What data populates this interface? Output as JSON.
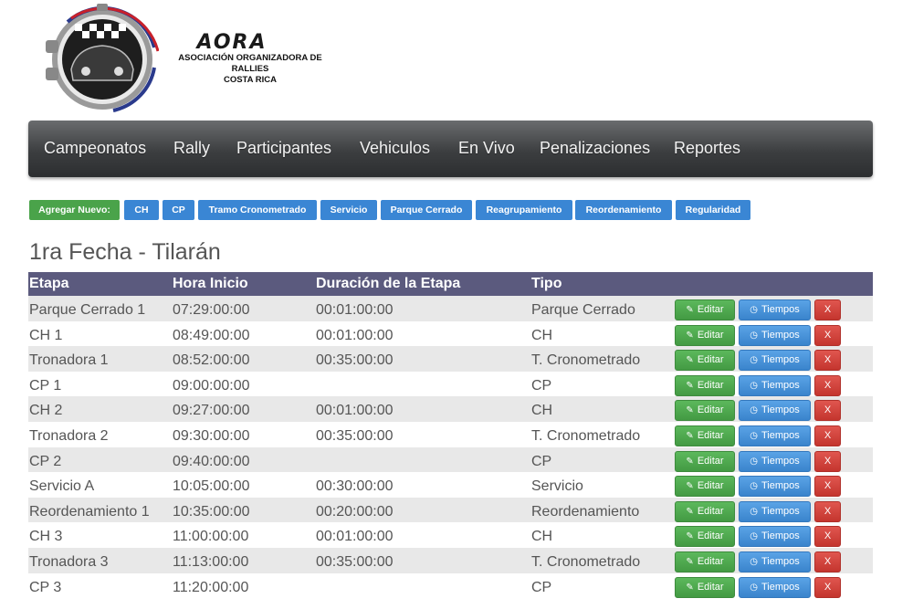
{
  "brand": {
    "name": "AORA",
    "line1": "ASOCIACIÓN ORGANIZADORA DE RALLIES",
    "line2": "COSTA RICA"
  },
  "nav": {
    "items": [
      "Campeonatos",
      "Rally",
      "Participantes",
      "Vehiculos",
      "En Vivo",
      "Penalizaciones",
      "Reportes"
    ]
  },
  "add_bar": {
    "label": "Agregar Nuevo:",
    "buttons": [
      "CH",
      "CP",
      "Tramo Cronometrado",
      "Servicio",
      "Parque Cerrado",
      "Reagrupamiento",
      "Reordenamiento",
      "Regularidad"
    ]
  },
  "page_title": "1ra Fecha - Tilarán",
  "table": {
    "headers": [
      "Etapa",
      "Hora Inicio",
      "Duración de la Etapa",
      "Tipo"
    ],
    "actions": {
      "edit": "Editar",
      "times": "Tiempos",
      "delete": "X"
    },
    "rows": [
      {
        "etapa": "Parque Cerrado 1",
        "hora": "07:29:00:00",
        "duracion": "00:01:00:00",
        "tipo": "Parque Cerrado"
      },
      {
        "etapa": "CH 1",
        "hora": "08:49:00:00",
        "duracion": "00:01:00:00",
        "tipo": "CH"
      },
      {
        "etapa": "Tronadora 1",
        "hora": "08:52:00:00",
        "duracion": "00:35:00:00",
        "tipo": "T. Cronometrado"
      },
      {
        "etapa": "CP 1",
        "hora": "09:00:00:00",
        "duracion": "",
        "tipo": "CP"
      },
      {
        "etapa": "CH 2",
        "hora": "09:27:00:00",
        "duracion": "00:01:00:00",
        "tipo": "CH"
      },
      {
        "etapa": "Tronadora 2",
        "hora": "09:30:00:00",
        "duracion": "00:35:00:00",
        "tipo": "T. Cronometrado"
      },
      {
        "etapa": "CP 2",
        "hora": "09:40:00:00",
        "duracion": "",
        "tipo": "CP"
      },
      {
        "etapa": "Servicio A",
        "hora": "10:05:00:00",
        "duracion": "00:30:00:00",
        "tipo": "Servicio"
      },
      {
        "etapa": "Reordenamiento 1",
        "hora": "10:35:00:00",
        "duracion": "00:20:00:00",
        "tipo": "Reordenamiento"
      },
      {
        "etapa": "CH 3",
        "hora": "11:00:00:00",
        "duracion": "00:01:00:00",
        "tipo": "CH"
      },
      {
        "etapa": "Tronadora 3",
        "hora": "11:13:00:00",
        "duracion": "00:35:00:00",
        "tipo": "T. Cronometrado"
      },
      {
        "etapa": "CP 3",
        "hora": "11:20:00:00",
        "duracion": "",
        "tipo": "CP"
      }
    ]
  },
  "colors": {
    "nav_bg": "#3c3e40",
    "table_header": "#5b5a7e",
    "add_green": "#4aa34a",
    "add_blue": "#3a86d4"
  }
}
